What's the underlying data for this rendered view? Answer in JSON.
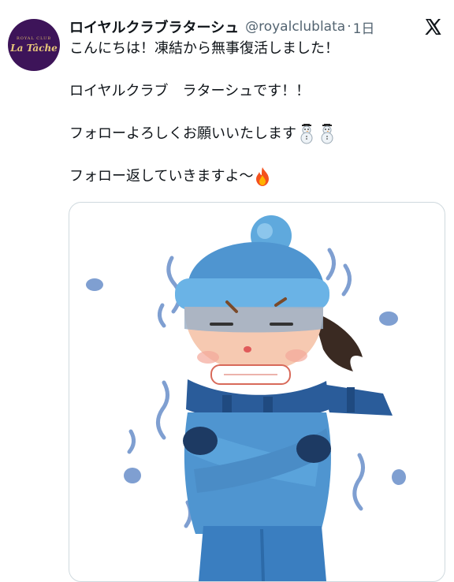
{
  "tweet": {
    "display_name": "ロイヤルクラブラターシュ",
    "handle": "@royalclublata",
    "separator": "·",
    "time": "1日",
    "avatar": {
      "top_text": "ROYAL CLUB",
      "logo_text": "La Tâche",
      "bg_color": "#3d1459",
      "text_color": "#e7c77a"
    },
    "lines": [
      "こんにちは！凍結から無事復活しました！",
      "ロイヤルクラブ　ラターシュです！！",
      "フォローよろしくお願いいたします",
      "フォロー返していきますよ〜"
    ],
    "emojis": {
      "line3": [
        "snowman-icon",
        "snowman-icon"
      ],
      "line4": [
        "fire-icon"
      ]
    },
    "media": {
      "description": "illustration",
      "icon": "freezing-person-illustration"
    }
  },
  "colors": {
    "text": "#0f1419",
    "secondary": "#536471",
    "border": "#cfd9de"
  }
}
